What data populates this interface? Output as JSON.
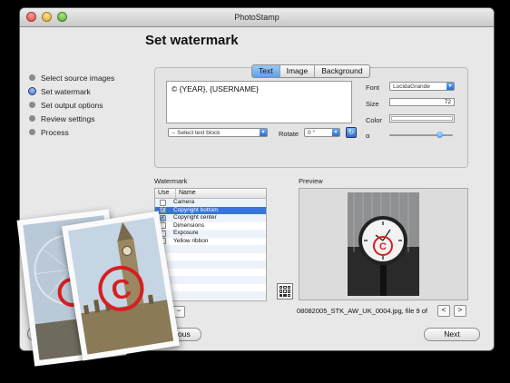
{
  "window": {
    "title": "PhotoStamp"
  },
  "page": {
    "heading": "Set watermark"
  },
  "steps": [
    {
      "label": "Select source images",
      "state": "done"
    },
    {
      "label": "Set watermark",
      "state": "current"
    },
    {
      "label": "Set output options",
      "state": "todo"
    },
    {
      "label": "Review settings",
      "state": "todo"
    },
    {
      "label": "Process",
      "state": "todo"
    }
  ],
  "tabs": [
    {
      "label": "Text",
      "selected": true
    },
    {
      "label": "Image",
      "selected": false
    },
    {
      "label": "Background",
      "selected": false
    }
  ],
  "editor": {
    "text": "© {YEAR}, {USERNAME}",
    "text_block_select": "-- Select text block",
    "rotate_label": "Rotate",
    "rotate_value": "0 °"
  },
  "format": {
    "font_label": "Font",
    "font_value": "LucidaGrande",
    "size_label": "Size",
    "size_value": "72",
    "color_label": "Color",
    "alpha_label": "α",
    "alpha_level": 0.8
  },
  "watermark": {
    "section_label": "Watermark",
    "col_use": "Use",
    "col_name": "Name",
    "rows": [
      {
        "name": "Camera",
        "checked": false,
        "selected": false
      },
      {
        "name": "Copyright bottom",
        "checked": true,
        "selected": true
      },
      {
        "name": "Copyright center",
        "checked": true,
        "selected": false
      },
      {
        "name": "Dimensions",
        "checked": false,
        "selected": false
      },
      {
        "name": "Exposure",
        "checked": false,
        "selected": false
      },
      {
        "name": "Yellow ribbon",
        "checked": false,
        "selected": false
      }
    ],
    "remove_label": "−"
  },
  "preview": {
    "section_label": "Preview",
    "file_info": "08082005_STK_AW_UK_0004.jpg, file 9 of",
    "prev_label": "<",
    "next_label": ">"
  },
  "footer": {
    "previous_label": "revious",
    "next_label": "Next",
    "help_label": "?"
  },
  "colors": {
    "accent": "#3875d7",
    "watermark_red": "#d42020"
  },
  "icons": {
    "rotate": "rotate-icon",
    "grid": "position-grid-icon",
    "help": "help-icon"
  }
}
